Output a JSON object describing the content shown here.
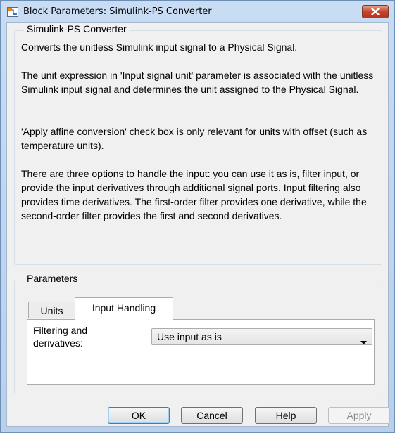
{
  "window": {
    "title": "Block Parameters: Simulink-PS Converter"
  },
  "block": {
    "group_title": "Simulink-PS Converter",
    "description": [
      "Converts the unitless Simulink input signal to a Physical Signal.",
      "The unit expression in 'Input signal unit' parameter is associated with the unitless Simulink input signal and determines the unit assigned to the Physical Signal.",
      "'Apply affine conversion' check box is only relevant for units with offset (such as temperature units).",
      "There are three options to handle the input: you can use it as is, filter input, or provide the input derivatives through additional signal ports. Input filtering also provides time derivatives. The first-order filter provides one derivative, while the second-order filter provides the first and second derivatives."
    ]
  },
  "parameters": {
    "group_title": "Parameters",
    "tabs": [
      {
        "label": "Units",
        "active": false
      },
      {
        "label": "Input Handling",
        "active": true
      }
    ],
    "filtering": {
      "label": "Filtering and derivatives:",
      "value": "Use input as is"
    }
  },
  "buttons": {
    "ok": "OK",
    "cancel": "Cancel",
    "help": "Help",
    "apply": "Apply"
  },
  "colors": {
    "titlebar": "#c8dcf3",
    "close_button": "#c7432b",
    "dialog_bg": "#f0f0f0"
  }
}
